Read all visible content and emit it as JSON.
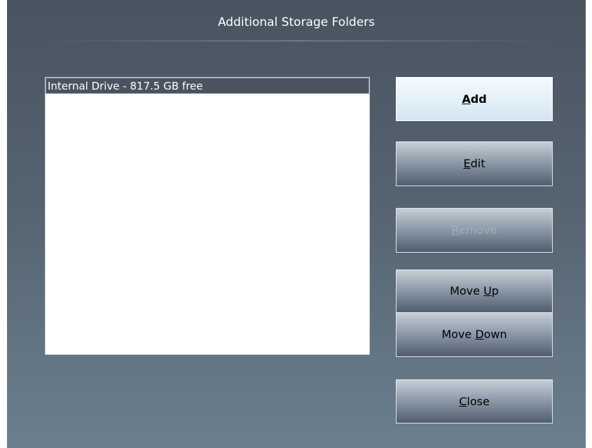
{
  "dialog": {
    "title": "Additional Storage Folders"
  },
  "list": {
    "items": [
      {
        "label": "Internal Drive - 817.5 GB free",
        "selected": true
      }
    ]
  },
  "buttons": {
    "add": {
      "mnemonic": "A",
      "rest": "dd",
      "enabled": true,
      "default": true
    },
    "edit": {
      "mnemonic": "E",
      "rest": "dit",
      "enabled": true
    },
    "remove": {
      "mnemonic": "R",
      "rest": "emove",
      "enabled": false
    },
    "move_up": {
      "prefix": "Move ",
      "mnemonic": "U",
      "rest": "p",
      "enabled": true
    },
    "move_down": {
      "prefix": "Move ",
      "mnemonic": "D",
      "rest": "own",
      "enabled": true
    },
    "close": {
      "mnemonic": "C",
      "rest": "lose",
      "enabled": true
    }
  },
  "colors": {
    "dialog_top": "#485460",
    "dialog_bottom": "#6b7f8e",
    "selected_item_bg": "#4a5460",
    "default_button_bg": "#e4f1f8",
    "disabled_text": "#a3aebb"
  }
}
